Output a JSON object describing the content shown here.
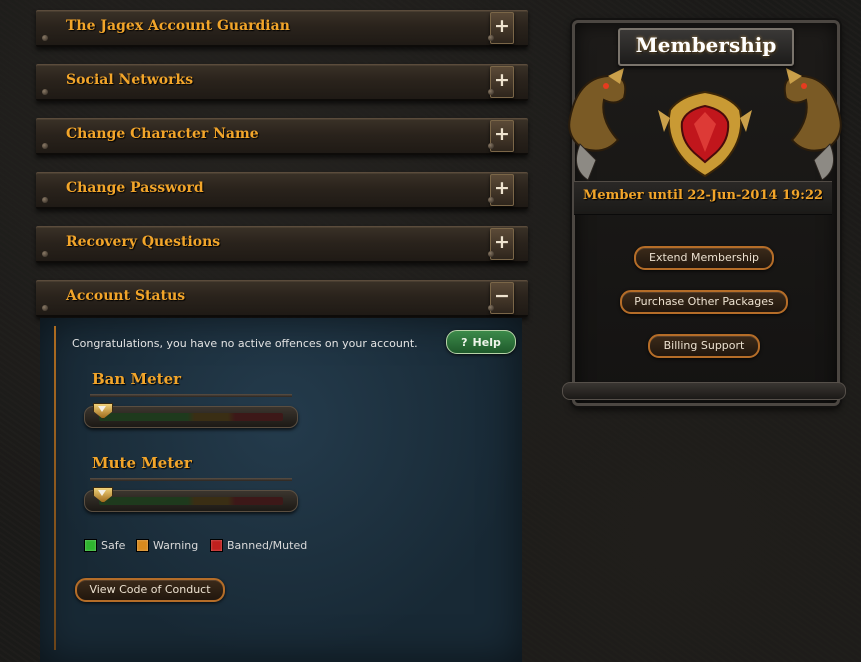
{
  "accordion": [
    {
      "label": "The Jagex Account Guardian",
      "toggle": "+"
    },
    {
      "label": "Social Networks",
      "toggle": "+"
    },
    {
      "label": "Change Character Name",
      "toggle": "+"
    },
    {
      "label": "Change Password",
      "toggle": "+"
    },
    {
      "label": "Recovery Questions",
      "toggle": "+"
    },
    {
      "label": "Account Status",
      "toggle": "−"
    }
  ],
  "account_status": {
    "message": "Congratulations, you have no active offences on your account.",
    "help_label": "Help",
    "help_icon": "?",
    "ban_meter": {
      "title": "Ban Meter",
      "level": 0
    },
    "mute_meter": {
      "title": "Mute Meter",
      "level": 0
    },
    "legend": [
      {
        "label": "Safe",
        "color": "#2fb52f"
      },
      {
        "label": "Warning",
        "color": "#d88a1e"
      },
      {
        "label": "Banned/Muted",
        "color": "#c0201e"
      }
    ],
    "conduct_button": "View Code of Conduct"
  },
  "membership": {
    "title": "Membership",
    "status": "Member until 22-Jun-2014 19:22",
    "buttons": [
      "Extend Membership",
      "Purchase Other Packages",
      "Billing Support"
    ]
  },
  "colors": {
    "accent_gold": "#f2a52a",
    "panel_blue": "#1a2b37",
    "button_border": "#b56d28"
  },
  "icons": [
    "plus-icon",
    "minus-icon",
    "help-icon",
    "dragon-icon",
    "shield-crest-icon"
  ]
}
